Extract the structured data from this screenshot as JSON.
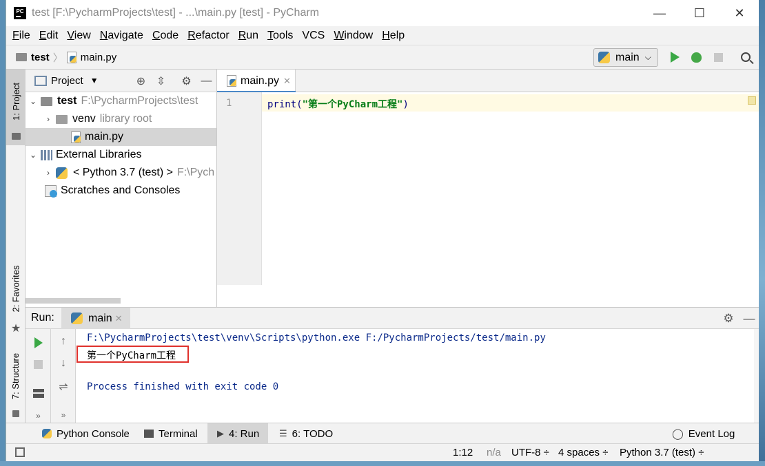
{
  "window": {
    "title": "test [F:\\PycharmProjects\\test] - ...\\main.py [test] - PyCharm",
    "logo": "PC",
    "minimize": "—",
    "maximize": "☐",
    "close": "✕"
  },
  "menu": [
    {
      "label": "File",
      "mnemonic": "F",
      "rest": "ile"
    },
    {
      "label": "Edit",
      "mnemonic": "E",
      "rest": "dit"
    },
    {
      "label": "View",
      "mnemonic": "V",
      "rest": "iew"
    },
    {
      "label": "Navigate",
      "mnemonic": "N",
      "rest": "avigate"
    },
    {
      "label": "Code",
      "mnemonic": "C",
      "rest": "ode"
    },
    {
      "label": "Refactor",
      "mnemonic": "R",
      "rest": "efactor"
    },
    {
      "label": "Run",
      "mnemonic": "R",
      "rest": "un"
    },
    {
      "label": "Tools",
      "mnemonic": "T",
      "rest": "ools"
    },
    {
      "label": "VCS",
      "mnemonic": "",
      "rest": "VCS"
    },
    {
      "label": "Window",
      "mnemonic": "W",
      "rest": "indow"
    },
    {
      "label": "Help",
      "mnemonic": "H",
      "rest": "elp"
    }
  ],
  "navbar": {
    "project": "test",
    "file": "main.py",
    "run_config": "main"
  },
  "left_stripe": {
    "project": "1: Project",
    "favorites": "2: Favorites",
    "structure": "7: Structure"
  },
  "project_panel": {
    "title": "Project",
    "tree": {
      "root_name": "test",
      "root_path": "F:\\PycharmProjects\\test",
      "venv_name": "venv",
      "venv_hint": "library root",
      "main_file": "main.py",
      "ext_libs": "External Libraries",
      "python_sdk": "< Python 3.7 (test) >",
      "python_sdk_path": "F:\\Pych",
      "scratches": "Scratches and Consoles"
    }
  },
  "editor": {
    "tab": "main.py",
    "line_number": "1",
    "code_fn": "print(",
    "code_str": "\"第一个PyCharm工程\"",
    "code_end": ")"
  },
  "run_window": {
    "label": "Run:",
    "tab": "main",
    "command": "F:\\PycharmProjects\\test\\venv\\Scripts\\python.exe F:/PycharmProjects/test/main.py",
    "output": "第一个PyCharm工程",
    "exit": "Process finished with exit code 0"
  },
  "bottom_tabs": {
    "python_console": "Python Console",
    "terminal": "Terminal",
    "run": "4: Run",
    "todo": "6: TODO",
    "event_log": "Event Log"
  },
  "status": {
    "position": "1:12",
    "na": "n/a",
    "encoding": "UTF-8 ÷",
    "indent": "4 spaces ÷",
    "interpreter": "Python 3.7 (test) ÷"
  }
}
